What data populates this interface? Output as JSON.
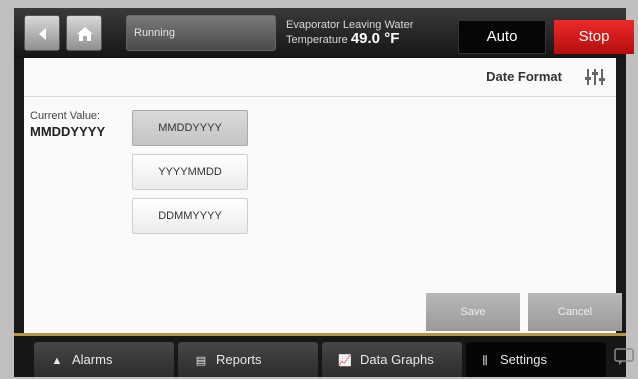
{
  "header": {
    "back_icon": "back-arrow-icon",
    "home_icon": "home-icon",
    "status_text": "Running",
    "evap_label_line1": "Evaporator Leaving Water",
    "evap_label_line2": "Temperature",
    "evap_value": "49.0 °F",
    "auto_label": "Auto",
    "stop_label": "Stop"
  },
  "page": {
    "title": "Date Format",
    "title_icon": "sliders-icon",
    "current_value_label": "Current Value:",
    "current_value": "MMDDYYYY",
    "options": [
      "MMDDYYYY",
      "YYYYMMDD",
      "DDMMYYYY"
    ],
    "selected_option": "MMDDYYYY",
    "save_label": "Save",
    "cancel_label": "Cancel"
  },
  "nav": {
    "tabs": [
      {
        "label": "Alarms",
        "icon": "alarm-icon"
      },
      {
        "label": "Reports",
        "icon": "report-icon"
      },
      {
        "label": "Data Graphs",
        "icon": "graph-icon"
      },
      {
        "label": "Settings",
        "icon": "settings-icon"
      }
    ],
    "active_tab": "Settings",
    "message_icon": "message-icon"
  },
  "colors": {
    "stop": "#d91c1c",
    "accent_gold": "#b89545",
    "top_bar": "#1e1e1e"
  }
}
